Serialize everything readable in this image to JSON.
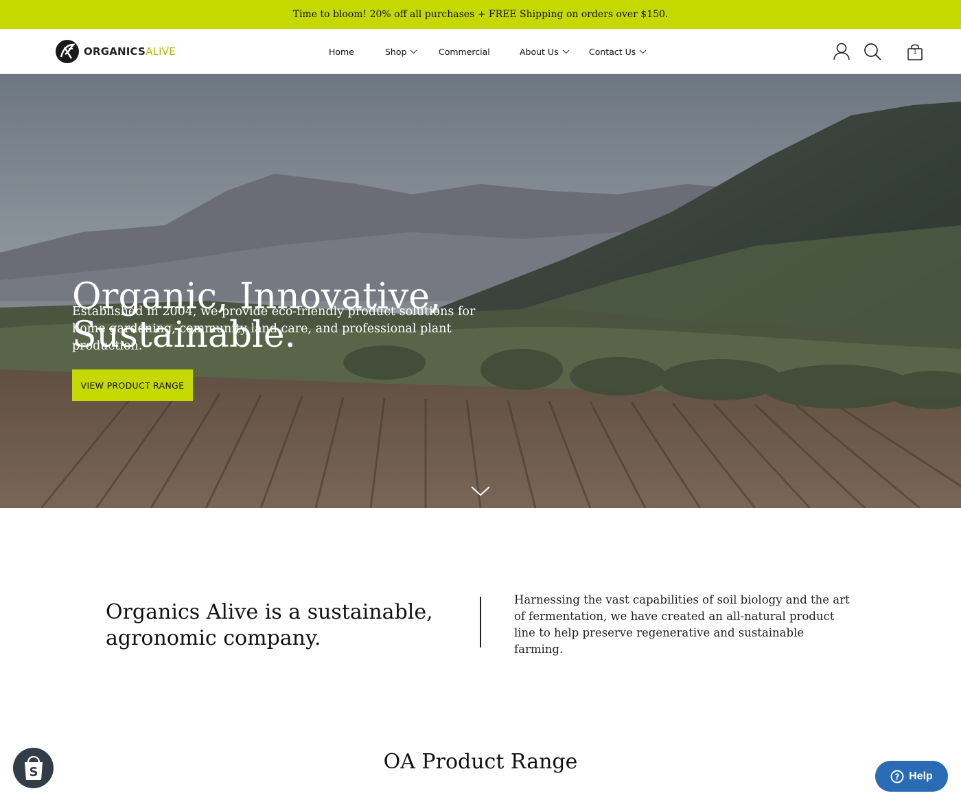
{
  "announcement": "Time to bloom! 20% off all purchases + FREE Shipping on orders over $150.",
  "brand": {
    "name_dark": "ORGANICS",
    "name_accent": "ALIVE",
    "accent_color": "#c5d800"
  },
  "nav": {
    "items": [
      {
        "label": "Home",
        "has_dropdown": false
      },
      {
        "label": "Shop",
        "has_dropdown": true
      },
      {
        "label": "Commercial",
        "has_dropdown": false
      },
      {
        "label": "About Us",
        "has_dropdown": true
      },
      {
        "label": "Contact Us",
        "has_dropdown": true
      }
    ]
  },
  "header_icons": {
    "account": "user-icon",
    "search": "search-icon",
    "cart": "shopping-bag-icon",
    "cart_count": "1"
  },
  "hero": {
    "title_line1": "Organic, Innovative,",
    "title_line2": "Sustainable.",
    "subtitle": "Established in 2004, we provide eco-friendly product solutions for home gardening, community land care, and professional plant production.",
    "cta_label": "VIEW PRODUCT RANGE",
    "scroll_icon": "chevron-down-icon"
  },
  "intro": {
    "heading": "Organics Alive is a sustainable, agronomic company.",
    "text": "Harnessing the vast capabilities of soil biology and the art of fermentation, we have created an all-natural product line to help preserve regenerative and sustainable farming."
  },
  "product_range": {
    "title": "OA Product Range"
  },
  "widgets": {
    "shopify_icon": "shopify-bag-icon",
    "help_label": "Help",
    "help_icon": "question-circle-icon"
  }
}
